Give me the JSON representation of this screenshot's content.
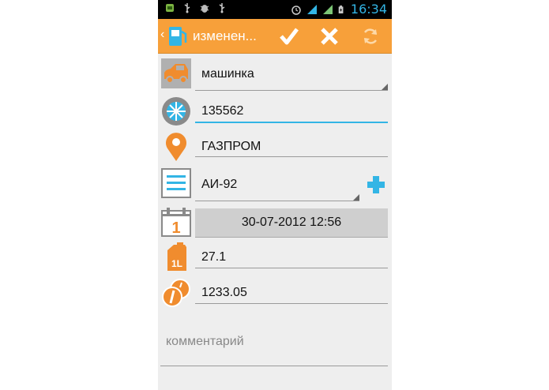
{
  "status_bar": {
    "time": "16:34",
    "left_icons": [
      "android-head-icon",
      "usb-icon",
      "bug-icon",
      "usb-icon"
    ],
    "right_icons": [
      "alarm-icon",
      "wifi-icon",
      "signal-icon",
      "battery-charging-icon"
    ]
  },
  "action_bar": {
    "title": "изменен...",
    "accent_color": "#f7a03a",
    "actions": [
      "check-icon",
      "close-icon",
      "refresh-icon"
    ]
  },
  "form": {
    "car": {
      "value": "машинка",
      "icon": "car-icon"
    },
    "mileage": {
      "value": "135562",
      "icon": "wheel-icon"
    },
    "station": {
      "value": "ГАЗПРОМ",
      "icon": "map-pin-icon"
    },
    "fuel_type": {
      "value": "АИ-92",
      "icon": "list-icon",
      "add_icon": "plus-icon"
    },
    "datetime": {
      "value": "30-07-2012 12:56",
      "icon": "calendar-icon",
      "calendar_day": "1"
    },
    "volume": {
      "value": "27.1",
      "icon": "fuel-can-icon",
      "icon_label": "1L"
    },
    "cost": {
      "value": "1233.05",
      "icon": "coins-icon"
    },
    "comment": {
      "placeholder": "комментарий"
    }
  },
  "colors": {
    "accent_orange": "#f7a03a",
    "accent_blue": "#33b5e5"
  }
}
